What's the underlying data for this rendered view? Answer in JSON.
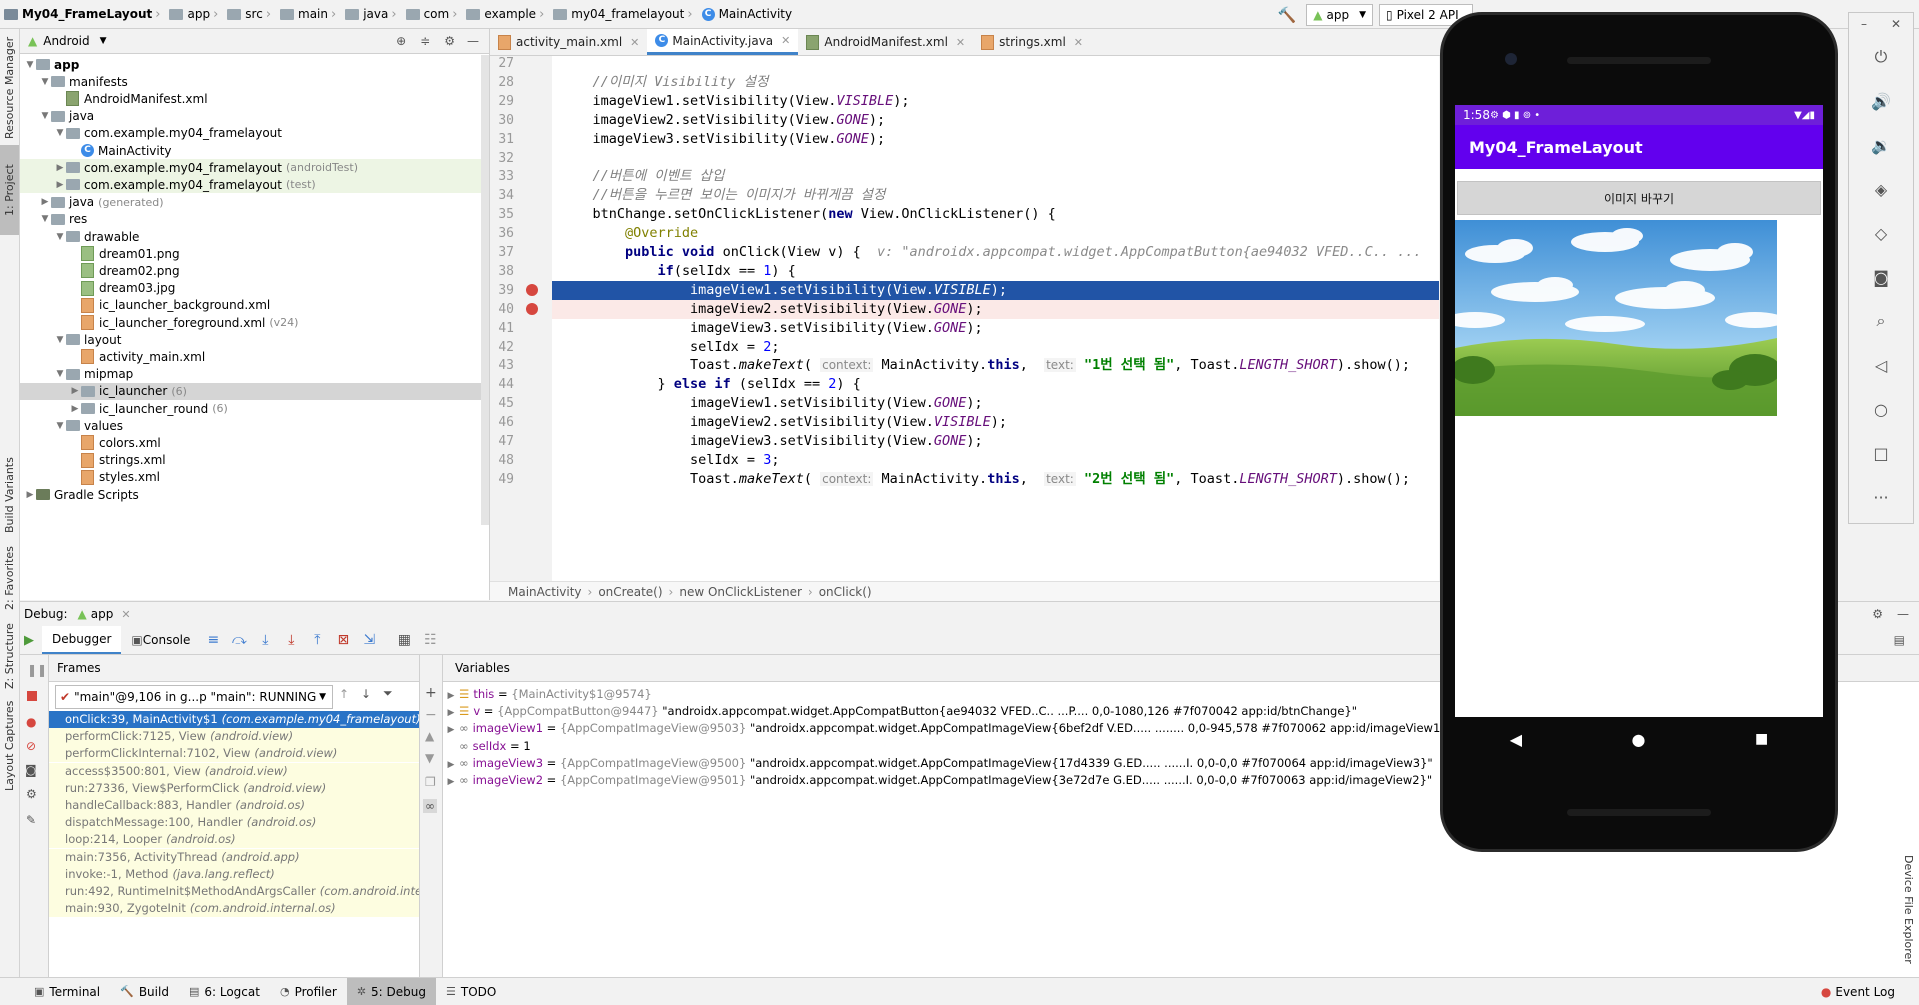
{
  "breadcrumb": [
    "My04_FrameLayout",
    "app",
    "src",
    "main",
    "java",
    "com",
    "example",
    "my04_framelayout",
    "MainActivity"
  ],
  "run_config": {
    "module": "app",
    "device": "Pixel 2 API"
  },
  "left_strip": {
    "top": [
      "Resource Manager",
      "1: Project"
    ],
    "bottom": [
      "Build Variants",
      "2: Favorites",
      "Z: Structure",
      "Layout Captures"
    ]
  },
  "project_panel": {
    "view": "Android",
    "tree": [
      {
        "label": "app",
        "depth": 0,
        "type": "module",
        "bold": true,
        "expanded": true
      },
      {
        "label": "manifests",
        "depth": 1,
        "type": "folder",
        "expanded": true
      },
      {
        "label": "AndroidManifest.xml",
        "depth": 2,
        "type": "manifest"
      },
      {
        "label": "java",
        "depth": 1,
        "type": "folder",
        "expanded": true
      },
      {
        "label": "com.example.my04_framelayout",
        "depth": 2,
        "type": "folder",
        "expanded": true
      },
      {
        "label": "MainActivity",
        "depth": 3,
        "type": "class"
      },
      {
        "label": "com.example.my04_framelayout",
        "suffix": "(androidTest)",
        "depth": 2,
        "type": "folder",
        "collapsed": true,
        "green": true
      },
      {
        "label": "com.example.my04_framelayout",
        "suffix": "(test)",
        "depth": 2,
        "type": "folder",
        "collapsed": true,
        "green": true
      },
      {
        "label": "java",
        "suffix": "(generated)",
        "depth": 1,
        "type": "folder",
        "collapsed": true
      },
      {
        "label": "res",
        "depth": 1,
        "type": "folder",
        "expanded": true
      },
      {
        "label": "drawable",
        "depth": 2,
        "type": "folder",
        "expanded": true
      },
      {
        "label": "dream01.png",
        "depth": 3,
        "type": "png"
      },
      {
        "label": "dream02.png",
        "depth": 3,
        "type": "png"
      },
      {
        "label": "dream03.jpg",
        "depth": 3,
        "type": "png"
      },
      {
        "label": "ic_launcher_background.xml",
        "depth": 3,
        "type": "xml"
      },
      {
        "label": "ic_launcher_foreground.xml",
        "suffix": "(v24)",
        "depth": 3,
        "type": "xml"
      },
      {
        "label": "layout",
        "depth": 2,
        "type": "folder",
        "expanded": true
      },
      {
        "label": "activity_main.xml",
        "depth": 3,
        "type": "xml"
      },
      {
        "label": "mipmap",
        "depth": 2,
        "type": "folder",
        "expanded": true
      },
      {
        "label": "ic_launcher",
        "suffix": "(6)",
        "depth": 3,
        "type": "folder",
        "collapsed": true,
        "selected": true
      },
      {
        "label": "ic_launcher_round",
        "suffix": "(6)",
        "depth": 3,
        "type": "folder",
        "collapsed": true
      },
      {
        "label": "values",
        "depth": 2,
        "type": "folder",
        "expanded": true
      },
      {
        "label": "colors.xml",
        "depth": 3,
        "type": "xml"
      },
      {
        "label": "strings.xml",
        "depth": 3,
        "type": "xml"
      },
      {
        "label": "styles.xml",
        "depth": 3,
        "type": "xml"
      },
      {
        "label": "Gradle Scripts",
        "depth": 0,
        "type": "gradle",
        "collapsed": true
      }
    ]
  },
  "editor": {
    "tabs": [
      {
        "label": "activity_main.xml",
        "type": "xml"
      },
      {
        "label": "MainActivity.java",
        "type": "class",
        "active": true
      },
      {
        "label": "AndroidManifest.xml",
        "type": "manifest"
      },
      {
        "label": "strings.xml",
        "type": "xml"
      }
    ],
    "lines": [
      {
        "n": "27",
        "html": ""
      },
      {
        "n": "28",
        "html": "<span class='cmt'>    //이미지 Visibility 설정</span>"
      },
      {
        "n": "29",
        "html": "    imageView1.setVisibility(View.<span class='fld'>VISIBLE</span>);"
      },
      {
        "n": "30",
        "html": "    imageView2.setVisibility(View.<span class='fld'>GONE</span>);"
      },
      {
        "n": "31",
        "html": "    imageView3.setVisibility(View.<span class='fld'>GONE</span>);"
      },
      {
        "n": "32",
        "html": ""
      },
      {
        "n": "33",
        "html": "<span class='cmt'>    //버튼에 이벤트 삽입</span>"
      },
      {
        "n": "34",
        "html": "<span class='cmt'>    //버튼을 누르면 보이는 이미지가 바뀌게끔 설정</span>"
      },
      {
        "n": "35",
        "html": "    btnChange.setOnClickListener(<span class='kw'>new</span> View.OnClickListener() {"
      },
      {
        "n": "36",
        "html": "        <span class='ann'>@Override</span>"
      },
      {
        "n": "37",
        "html": "        <span class='kw'>public void</span> onClick(View v) {  <span class='dbgval'>v: \"androidx.appcompat.widget.AppCompatButton{ae94032 VFED..C.. ...</span>"
      },
      {
        "n": "38",
        "html": "            <span class='kw'>if</span>(selIdx == <span style='color:#0000ff'>1</span>) {"
      },
      {
        "n": "39",
        "html": "                imageView1.setVisibility(View.<span class='fld'>VISIBLE</span>);",
        "exec": true
      },
      {
        "n": "40",
        "html": "                imageView2.setVisibility(View.<span class='fld'>GONE</span>);",
        "bp": true
      },
      {
        "n": "41",
        "html": "                imageView3.setVisibility(View.<span class='fld'>GONE</span>);"
      },
      {
        "n": "42",
        "html": "                selIdx = <span style='color:#0000ff'>2</span>;"
      },
      {
        "n": "43",
        "html": "                Toast.<span style='font-style:italic'>makeText</span>( <span class='hint'>context:</span> MainActivity.<span class='kw'>this</span>,  <span class='hint'>text:</span> <span class='str'>\"1번 선택 됨\"</span>, Toast.<span class='fld'>LENGTH_SHORT</span>).show();"
      },
      {
        "n": "44",
        "html": "            } <span class='kw'>else if</span> (selIdx == <span style='color:#0000ff'>2</span>) {"
      },
      {
        "n": "45",
        "html": "                imageView1.setVisibility(View.<span class='fld'>GONE</span>);"
      },
      {
        "n": "46",
        "html": "                imageView2.setVisibility(View.<span class='fld'>VISIBLE</span>);"
      },
      {
        "n": "47",
        "html": "                imageView3.setVisibility(View.<span class='fld'>GONE</span>);"
      },
      {
        "n": "48",
        "html": "                selIdx = <span style='color:#0000ff'>3</span>;"
      },
      {
        "n": "49",
        "html": "                Toast.<span style='font-style:italic'>makeText</span>( <span class='hint'>context:</span> MainActivity.<span class='kw'>this</span>,  <span class='hint'>text:</span> <span class='str'>\"2번 선택 됨\"</span>, Toast.<span class='fld'>LENGTH_SHORT</span>).show();"
      }
    ],
    "breadcrumb": [
      "MainActivity",
      "onCreate()",
      "new OnClickListener",
      "onClick()"
    ]
  },
  "debug": {
    "label": "Debug:",
    "config": "app",
    "tabs": [
      {
        "label": "Debugger",
        "active": true
      },
      {
        "label": "Console"
      }
    ],
    "frames_title": "Frames",
    "thread": "\"main\"@9,106 in g...p \"main\": RUNNING",
    "frames": [
      {
        "text": "onClick:39, MainActivity$1",
        "pkg": "(com.example.my04_framelayout)",
        "selected": true
      },
      {
        "text": "performClick:7125, View",
        "pkg": "(android.view)"
      },
      {
        "text": "performClickInternal:7102, View",
        "pkg": "(android.view)"
      },
      {
        "text": "access$3500:801, View",
        "pkg": "(android.view)"
      },
      {
        "text": "run:27336, View$PerformClick",
        "pkg": "(android.view)"
      },
      {
        "text": "handleCallback:883, Handler",
        "pkg": "(android.os)"
      },
      {
        "text": "dispatchMessage:100, Handler",
        "pkg": "(android.os)"
      },
      {
        "text": "loop:214, Looper",
        "pkg": "(android.os)"
      },
      {
        "text": "main:7356, ActivityThread",
        "pkg": "(android.app)"
      },
      {
        "text": "invoke:-1, Method",
        "pkg": "(java.lang.reflect)"
      },
      {
        "text": "run:492, RuntimeInit$MethodAndArgsCaller",
        "pkg": "(com.android.interna"
      },
      {
        "text": "main:930, ZygoteInit",
        "pkg": "(com.android.internal.os)"
      }
    ],
    "variables_title": "Variables",
    "variables": [
      {
        "name": "this",
        "type": "{MainActivity$1@9574}",
        "value": "",
        "icon": "field"
      },
      {
        "name": "v",
        "type": "{AppCompatButton@9447}",
        "value": "\"androidx.appcompat.widget.AppCompatButton{ae94032 VFED..C.. ...P.... 0,0-1080,126 #7f070042 app:id/btnChange}\"",
        "icon": "field"
      },
      {
        "name": "imageView1",
        "type": "{AppCompatImageView@9503}",
        "value": "\"androidx.appcompat.widget.AppCompatImageView{6bef2df V.ED..... ........ 0,0-945,578 #7f070062 app:id/imageView1}\"",
        "icon": "watch"
      },
      {
        "name": "selIdx",
        "type": "",
        "value": "1",
        "icon": "watch",
        "prim": true
      },
      {
        "name": "imageView3",
        "type": "{AppCompatImageView@9500}",
        "value": "\"androidx.appcompat.widget.AppCompatImageView{17d4339 G.ED..... ......I. 0,0-0,0 #7f070064 app:id/imageView3}\"",
        "icon": "watch"
      },
      {
        "name": "imageView2",
        "type": "{AppCompatImageView@9501}",
        "value": "\"androidx.appcompat.widget.AppCompatImageView{3e72d7e G.ED..... ......I. 0,0-0,0 #7f070063 app:id/imageView2}\"",
        "icon": "watch"
      }
    ]
  },
  "statusbar": {
    "tabs": [
      {
        "label": "Terminal"
      },
      {
        "label": "Build"
      },
      {
        "label": "6: Logcat"
      },
      {
        "label": "Profiler"
      },
      {
        "label": "5: Debug",
        "active": true
      },
      {
        "label": "TODO"
      }
    ],
    "event_log": "Event Log",
    "right_vtab": "Device File Explorer"
  },
  "emulator": {
    "time": "1:58",
    "app_title": "My04_FrameLayout",
    "button_label": "이미지 바꾸기"
  },
  "colors": {
    "accent": "#4083c9",
    "exec_line": "#2154a6",
    "app_bar": "#6200ee",
    "frame_selected": "#2973c6"
  }
}
